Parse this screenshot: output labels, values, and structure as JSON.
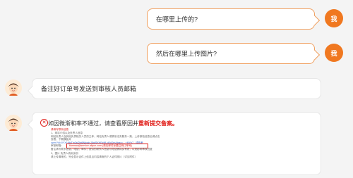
{
  "chat": {
    "user_avatar_label": "我",
    "messages": [
      {
        "role": "user",
        "text": "在哪里上传的?"
      },
      {
        "role": "user",
        "text": "然后在哪里上传图片?"
      },
      {
        "role": "bot",
        "text": "备注好订单号发送到审核人员邮箱"
      }
    ],
    "bot_image_message": {
      "title_prefix": "如因微渐和率不通过，请查看原因并",
      "title_highlight": "重新提交备案。",
      "lines": [
        "请填写联系信息",
        "1、网站介绍以及负责人信息",
        "网站负责人及其他负责相关人员的主体、网站负责人或联系法务服务一致，上传核验信息后请点击",
        "查看，下载模板并",
        "open?id=0YX19fqTm3sf2bt6NdgdvJ8gISKHEz9fLoBoDmAtgsv=...+MYb7...或参考",
        "备注请写联系信息，电话，邮件；提供的联系人信息与电话需真实有效，以免影响审核进度",
        "审核邮箱：",
        "tianmao@service.aliyun.com  (请在邮件标题注明订单号)",
        "2、图片 负责人真实身份",
        "请上传清晰的、完全显示证件上信息且内容清晰的个人证件照片（详见附件）"
      ]
    }
  },
  "colors": {
    "accent": "#f07820",
    "error": "#e0201b"
  }
}
